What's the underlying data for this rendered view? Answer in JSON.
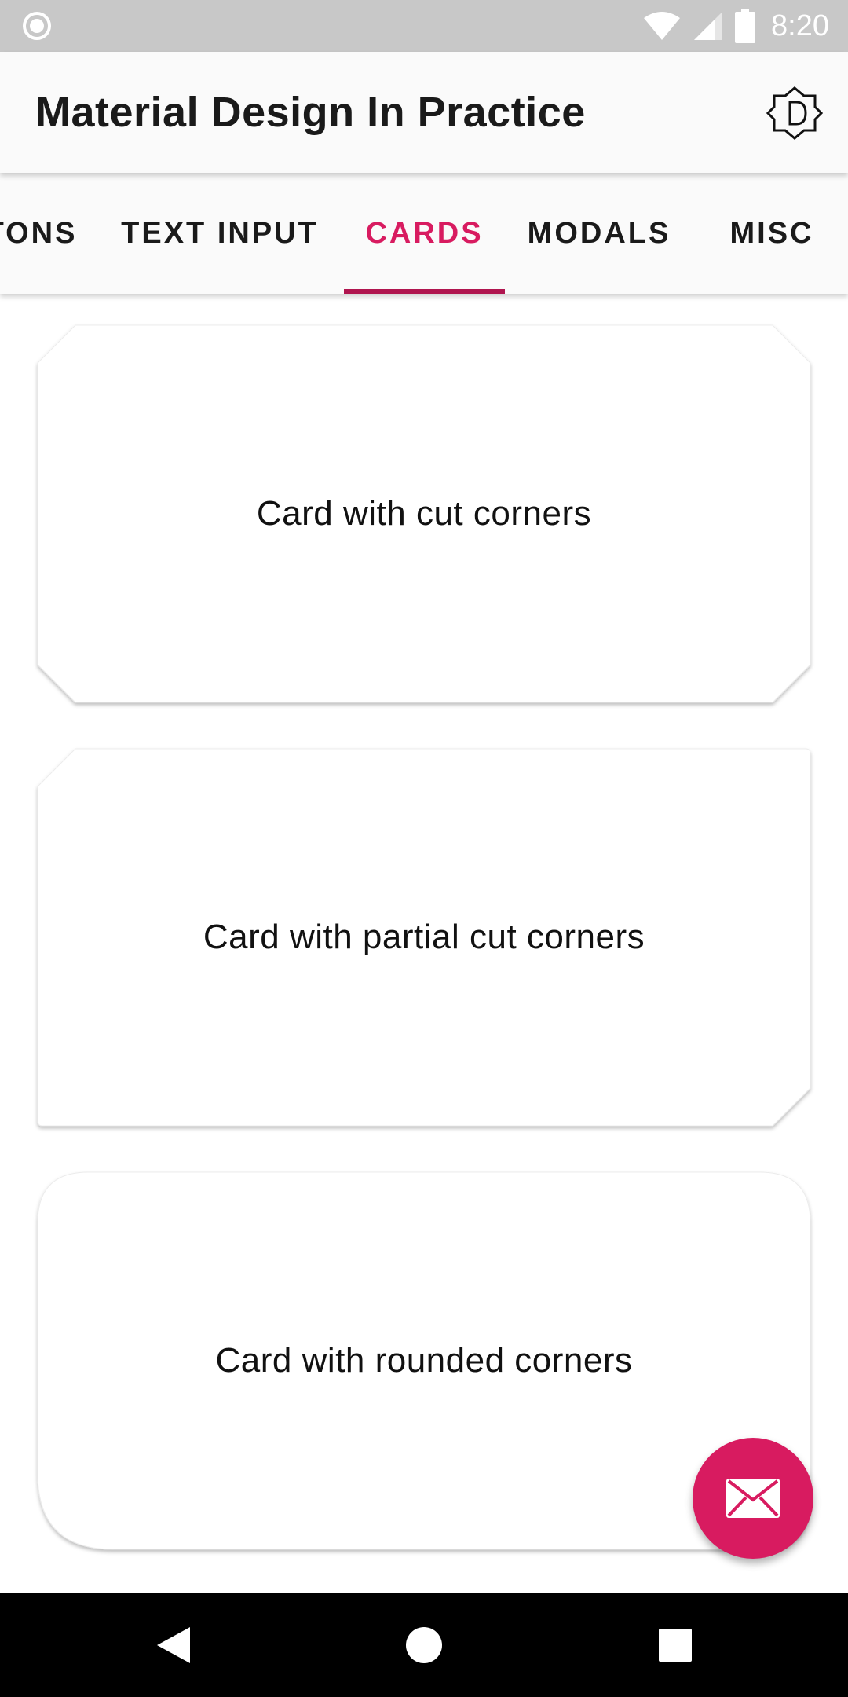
{
  "status_bar": {
    "time": "8:20",
    "icons": [
      "notification-circle-icon",
      "wifi-icon",
      "cellular-signal-icon",
      "battery-icon"
    ]
  },
  "app_bar": {
    "title": "Material Design In Practice",
    "action_icon": "theme-toggle-icon"
  },
  "tabs": {
    "items": [
      {
        "label": "TONS"
      },
      {
        "label": "TEXT INPUT"
      },
      {
        "label": "CARDS"
      },
      {
        "label": "MODALS"
      },
      {
        "label": "MISC"
      }
    ],
    "active_index": 2
  },
  "cards": [
    {
      "label": "Card with cut corners",
      "shape": "cut-all"
    },
    {
      "label": "Card with partial cut corners",
      "shape": "cut-partial"
    },
    {
      "label": "Card with rounded corners",
      "shape": "rounded-partial"
    }
  ],
  "fab": {
    "icon": "email-icon"
  },
  "nav_bar": {
    "icons": [
      "back-icon",
      "home-icon",
      "recents-icon"
    ]
  },
  "colors": {
    "accent": "#d81b60",
    "indicator": "#b0154f",
    "status_bar": "#c8c8c8",
    "app_bar": "#fafafa",
    "nav_bar": "#000000"
  }
}
